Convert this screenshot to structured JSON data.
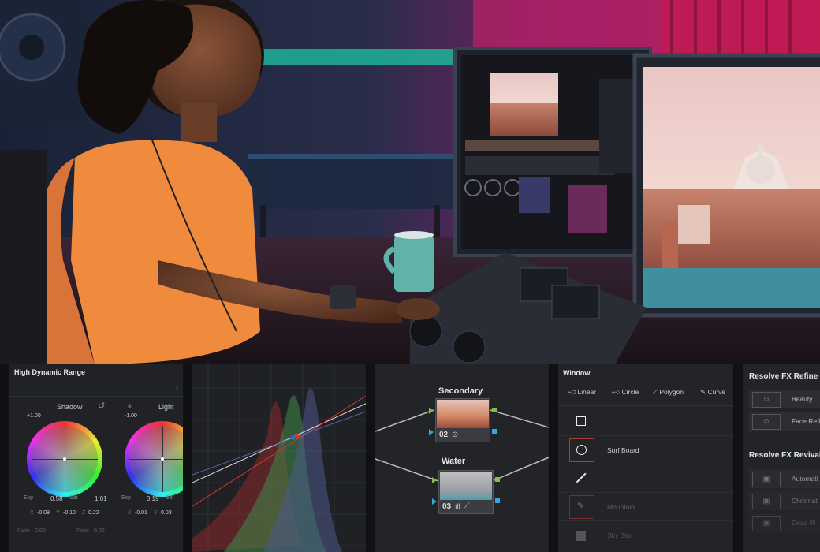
{
  "hdr": {
    "title": "High Dynamic Range",
    "shadow": "Shadow",
    "light": "Light",
    "shadow_val": "+1.00",
    "light_val": "-1.00",
    "exp_label": "Exp",
    "sat_label": "Sat",
    "shadow_exp": "0.58",
    "shadow_sat": "1.01",
    "light_exp": "0.19",
    "light_sat": "1.00",
    "x_label": "X",
    "y_label": "Y",
    "z_label": "Z",
    "shadow_x": "-0.09",
    "shadow_y": "-0.10",
    "shadow_z": "0.22",
    "light_x": "-0.01",
    "light_y": "0.03",
    "light_z": "0.00",
    "fade_label": "Fade",
    "fade_val1": "0.00",
    "fade_val2": "0.00"
  },
  "nodes": {
    "secondary_label": "Secondary",
    "secondary_num": "02",
    "water_label": "Water",
    "water_num": "03"
  },
  "window": {
    "title": "Window",
    "tools": [
      "Linear",
      "Circle",
      "Polygon",
      "Curve"
    ],
    "items": [
      "",
      "Surf Board",
      "",
      "Mountain",
      "Sky Blur"
    ]
  },
  "fx": {
    "refine_title": "Resolve FX Refine",
    "refine_items": [
      "Beauty",
      "Face Refi"
    ],
    "revival_title": "Resolve FX Revival",
    "revival_items": [
      "Automati",
      "Chromati",
      "Dead Pi"
    ]
  }
}
